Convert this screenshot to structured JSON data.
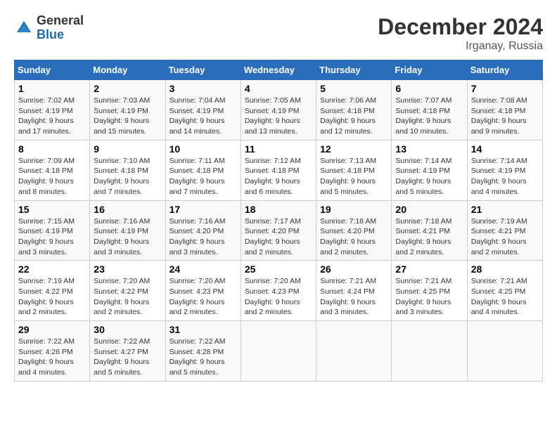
{
  "logo": {
    "general": "General",
    "blue": "Blue"
  },
  "title": "December 2024",
  "subtitle": "Irganay, Russia",
  "days_of_week": [
    "Sunday",
    "Monday",
    "Tuesday",
    "Wednesday",
    "Thursday",
    "Friday",
    "Saturday"
  ],
  "weeks": [
    [
      {
        "day": "1",
        "sunrise": "7:02 AM",
        "sunset": "4:19 PM",
        "daylight": "9 hours and 17 minutes."
      },
      {
        "day": "2",
        "sunrise": "7:03 AM",
        "sunset": "4:19 PM",
        "daylight": "9 hours and 15 minutes."
      },
      {
        "day": "3",
        "sunrise": "7:04 AM",
        "sunset": "4:19 PM",
        "daylight": "9 hours and 14 minutes."
      },
      {
        "day": "4",
        "sunrise": "7:05 AM",
        "sunset": "4:19 PM",
        "daylight": "9 hours and 13 minutes."
      },
      {
        "day": "5",
        "sunrise": "7:06 AM",
        "sunset": "4:18 PM",
        "daylight": "9 hours and 12 minutes."
      },
      {
        "day": "6",
        "sunrise": "7:07 AM",
        "sunset": "4:18 PM",
        "daylight": "9 hours and 10 minutes."
      },
      {
        "day": "7",
        "sunrise": "7:08 AM",
        "sunset": "4:18 PM",
        "daylight": "9 hours and 9 minutes."
      }
    ],
    [
      {
        "day": "8",
        "sunrise": "7:09 AM",
        "sunset": "4:18 PM",
        "daylight": "9 hours and 8 minutes."
      },
      {
        "day": "9",
        "sunrise": "7:10 AM",
        "sunset": "4:18 PM",
        "daylight": "9 hours and 7 minutes."
      },
      {
        "day": "10",
        "sunrise": "7:11 AM",
        "sunset": "4:18 PM",
        "daylight": "9 hours and 7 minutes."
      },
      {
        "day": "11",
        "sunrise": "7:12 AM",
        "sunset": "4:18 PM",
        "daylight": "9 hours and 6 minutes."
      },
      {
        "day": "12",
        "sunrise": "7:13 AM",
        "sunset": "4:18 PM",
        "daylight": "9 hours and 5 minutes."
      },
      {
        "day": "13",
        "sunrise": "7:14 AM",
        "sunset": "4:19 PM",
        "daylight": "9 hours and 5 minutes."
      },
      {
        "day": "14",
        "sunrise": "7:14 AM",
        "sunset": "4:19 PM",
        "daylight": "9 hours and 4 minutes."
      }
    ],
    [
      {
        "day": "15",
        "sunrise": "7:15 AM",
        "sunset": "4:19 PM",
        "daylight": "9 hours and 3 minutes."
      },
      {
        "day": "16",
        "sunrise": "7:16 AM",
        "sunset": "4:19 PM",
        "daylight": "9 hours and 3 minutes."
      },
      {
        "day": "17",
        "sunrise": "7:16 AM",
        "sunset": "4:20 PM",
        "daylight": "9 hours and 3 minutes."
      },
      {
        "day": "18",
        "sunrise": "7:17 AM",
        "sunset": "4:20 PM",
        "daylight": "9 hours and 2 minutes."
      },
      {
        "day": "19",
        "sunrise": "7:18 AM",
        "sunset": "4:20 PM",
        "daylight": "9 hours and 2 minutes."
      },
      {
        "day": "20",
        "sunrise": "7:18 AM",
        "sunset": "4:21 PM",
        "daylight": "9 hours and 2 minutes."
      },
      {
        "day": "21",
        "sunrise": "7:19 AM",
        "sunset": "4:21 PM",
        "daylight": "9 hours and 2 minutes."
      }
    ],
    [
      {
        "day": "22",
        "sunrise": "7:19 AM",
        "sunset": "4:22 PM",
        "daylight": "9 hours and 2 minutes."
      },
      {
        "day": "23",
        "sunrise": "7:20 AM",
        "sunset": "4:22 PM",
        "daylight": "9 hours and 2 minutes."
      },
      {
        "day": "24",
        "sunrise": "7:20 AM",
        "sunset": "4:23 PM",
        "daylight": "9 hours and 2 minutes."
      },
      {
        "day": "25",
        "sunrise": "7:20 AM",
        "sunset": "4:23 PM",
        "daylight": "9 hours and 2 minutes."
      },
      {
        "day": "26",
        "sunrise": "7:21 AM",
        "sunset": "4:24 PM",
        "daylight": "9 hours and 3 minutes."
      },
      {
        "day": "27",
        "sunrise": "7:21 AM",
        "sunset": "4:25 PM",
        "daylight": "9 hours and 3 minutes."
      },
      {
        "day": "28",
        "sunrise": "7:21 AM",
        "sunset": "4:25 PM",
        "daylight": "9 hours and 4 minutes."
      }
    ],
    [
      {
        "day": "29",
        "sunrise": "7:22 AM",
        "sunset": "4:26 PM",
        "daylight": "9 hours and 4 minutes."
      },
      {
        "day": "30",
        "sunrise": "7:22 AM",
        "sunset": "4:27 PM",
        "daylight": "9 hours and 5 minutes."
      },
      {
        "day": "31",
        "sunrise": "7:22 AM",
        "sunset": "4:28 PM",
        "daylight": "9 hours and 5 minutes."
      },
      null,
      null,
      null,
      null
    ]
  ],
  "labels": {
    "sunrise": "Sunrise:",
    "sunset": "Sunset:",
    "daylight": "Daylight:"
  }
}
